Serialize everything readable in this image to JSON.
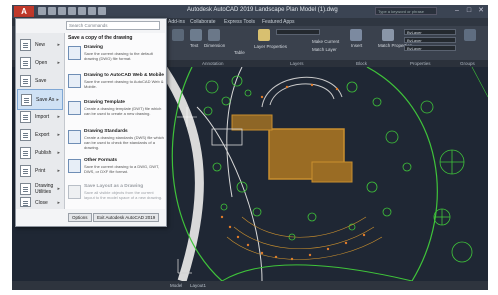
{
  "titlebar": {
    "app_logo": "A",
    "title": "Autodesk AutoCAD 2019   Landscape Plan Model (1).dwg",
    "search_placeholder": "Type a keyword or phrase"
  },
  "ribbon_tabs": [
    "Add-ins",
    "Collaborate",
    "Express Tools",
    "Featured Apps"
  ],
  "ribbon": {
    "text_label": "Text",
    "dimension_label": "Dimension",
    "table_label": "Table",
    "layer_properties_label": "Layer Properties",
    "make_current_label": "Make Current",
    "match_layer_label": "Match Layer",
    "insert_label": "Insert",
    "match_properties_label": "Match Properties",
    "bylayer_1": "ByLayer",
    "bylayer_2": "ByLayer",
    "bylayer_3": "ByLayer"
  },
  "panels": [
    "Annotation",
    "Layers",
    "Block",
    "Properties",
    "Groups"
  ],
  "app_menu": {
    "search_placeholder": "Search Commands",
    "items": [
      {
        "label": "New"
      },
      {
        "label": "Open"
      },
      {
        "label": "Save"
      },
      {
        "label": "Save As"
      },
      {
        "label": "Import"
      },
      {
        "label": "Export"
      },
      {
        "label": "Publish"
      },
      {
        "label": "Print"
      },
      {
        "label": "Drawing Utilities"
      },
      {
        "label": "Close"
      }
    ],
    "submenu": {
      "title": "Save a copy of the drawing",
      "entries": [
        {
          "title": "Drawing",
          "desc": "Save the current drawing to the default drawing (DWG) file format."
        },
        {
          "title": "Drawing to AutoCAD Web & Mobile",
          "desc": "Save the current drawing to AutoCAD Web & Mobile."
        },
        {
          "title": "Drawing Template",
          "desc": "Create a drawing template (DWT) file which can be used to create a new drawing."
        },
        {
          "title": "Drawing Standards",
          "desc": "Create a drawing standards (DWS) file which can be used to check the standards of a drawing."
        },
        {
          "title": "Other Formats",
          "desc": "Save the current drawing to a DWG, DWT, DWS, or DXF file format."
        },
        {
          "title": "Save Layout as a Drawing",
          "desc": "Save all visible objects from the current layout to the model space of a new drawing."
        }
      ]
    },
    "options_label": "Options",
    "exit_label": "Exit Autodesk AutoCAD 2019"
  },
  "statusbar": {
    "model_tab": "Model",
    "layout1_tab": "Layout1"
  },
  "colors": {
    "drawing_bg": "#1f2734",
    "building": "#c98f2e",
    "plants": "#3fc43a",
    "paths": "#d9d9d9",
    "accent_red": "#c0392b"
  }
}
